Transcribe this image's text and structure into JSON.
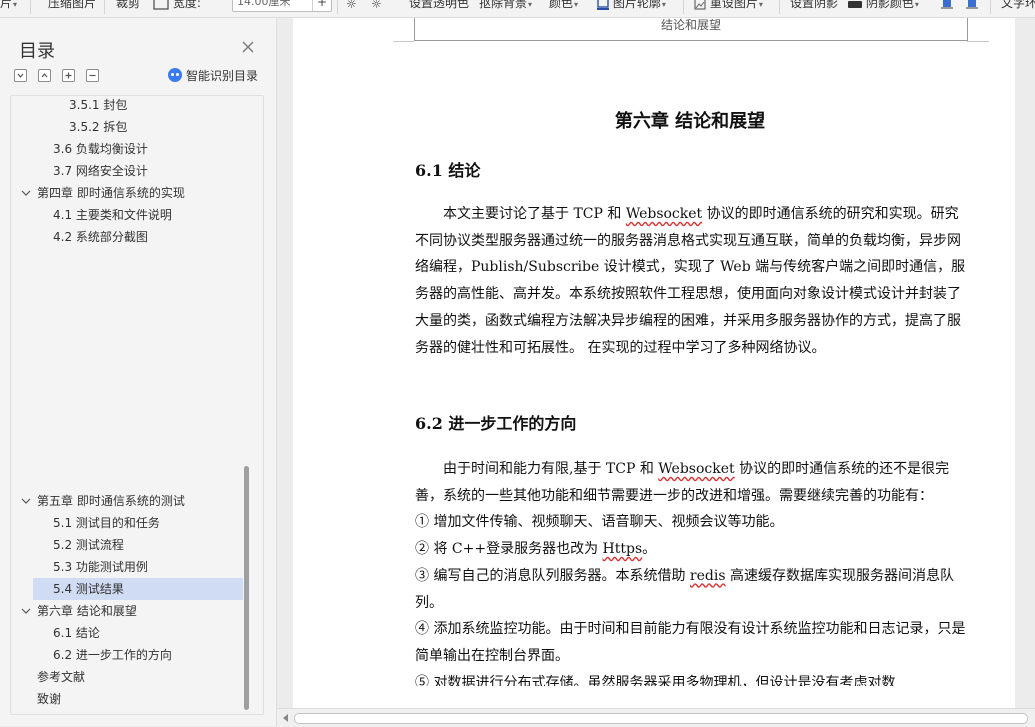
{
  "toolbar": {
    "item_pic_cut": "片",
    "compress": "压缩图片",
    "crop": "裁剪",
    "width_label": "宽度:",
    "width_value": "14.00厘米",
    "plus": "+",
    "set_transparent": "设置透明色",
    "remove_bg": "抠除背景",
    "color": "颜色",
    "pic_outline": "图片轮廓",
    "reset_pic": "重设图片",
    "set_shadow": "设置阴影",
    "shadow_color": "阴影颜色",
    "text_wrap": "文字环"
  },
  "toc": {
    "title": "目录",
    "smart_label": "智能识别目录",
    "items": [
      {
        "label": "3.5.1 封包",
        "level": 3
      },
      {
        "label": "3.5.2 拆包",
        "level": 3
      },
      {
        "label": "3.6 负载均衡设计",
        "level": 2
      },
      {
        "label": "3.7 网络安全设计",
        "level": 2
      },
      {
        "label": "第四章  即时通信系统的实现",
        "level": 1,
        "expanded": true
      },
      {
        "label": "4.1 主要类和文件说明",
        "level": 2
      },
      {
        "label": "4.2 系统部分截图",
        "level": 2
      },
      {
        "label": "第五章  即时通信系统的测试",
        "level": 1,
        "expanded": true
      },
      {
        "label": "5.1 测试目的和任务",
        "level": 2
      },
      {
        "label": "5.2 测试流程",
        "level": 2
      },
      {
        "label": "5.3  功能测试用例",
        "level": 2
      },
      {
        "label": "5.4  测试结果",
        "level": 2,
        "selected": true
      },
      {
        "label": "第六章  结论和展望",
        "level": 1,
        "expanded": true
      },
      {
        "label": "6.1  结论",
        "level": 2
      },
      {
        "label": "6.2  进一步工作的方向",
        "level": 2
      },
      {
        "label": "参考文献",
        "level": 1
      },
      {
        "label": "致谢",
        "level": 1
      }
    ]
  },
  "doc": {
    "header": "结论和展望",
    "chapter_title": "第六章  结论和展望",
    "sec1_title": "6.1  结论",
    "sec1_text": {
      "a": "本文主要讨论了基于 TCP 和 ",
      "b": "Websocket",
      "c": " 协议的即时通信系统的研究和实现。研究不同协议类型服务器通过统一的服务器消息格式实现互通互联，简单的负载均衡，异步网络编程，Publish/Subscribe 设计模式，实现了 Web 端与传统客户端之间即时通信，服务器的高性能、高并发。本系统按照软件工程思想，使用面向对象设计模式设计并封装了大量的类，函数式编程方法解决异步编程的困难，并采用多服务器协作的方式，提高了服务器的健壮性和可拓展性。  在实现的过程中学习了多种网络协议。"
    },
    "sec2_title": "6.2  进一步工作的方向",
    "sec2_text": {
      "a": "由于时间和能力有限,基于 TCP 和 ",
      "b": "Websocket",
      "c": " 协议的即时通信系统的还不是很完善，系统的一些其他功能和细节需要进一步的改进和增强。需要继续完善的功能有："
    },
    "item1": "①  增加文件传输、视频聊天、语音聊天、视频会议等功能。",
    "item2": {
      "a": "②  将 C++登录服务器也改为 ",
      "b": "Https",
      "c": "。"
    },
    "item3": {
      "a": "③  编写自己的消息队列服务器。本系统借助 ",
      "b": "redis",
      "c": " 高速缓存数据库实现服务器间消息队列。"
    },
    "item4": "④  添加系统监控功能。由于时间和目前能力有限没有设计系统监控功能和日志记录，只是简单输出在控制台界面。",
    "item5": "⑤  对数据进行分布式存储。虽然服务器采用多物理机，但设计是没有考虑对数"
  }
}
